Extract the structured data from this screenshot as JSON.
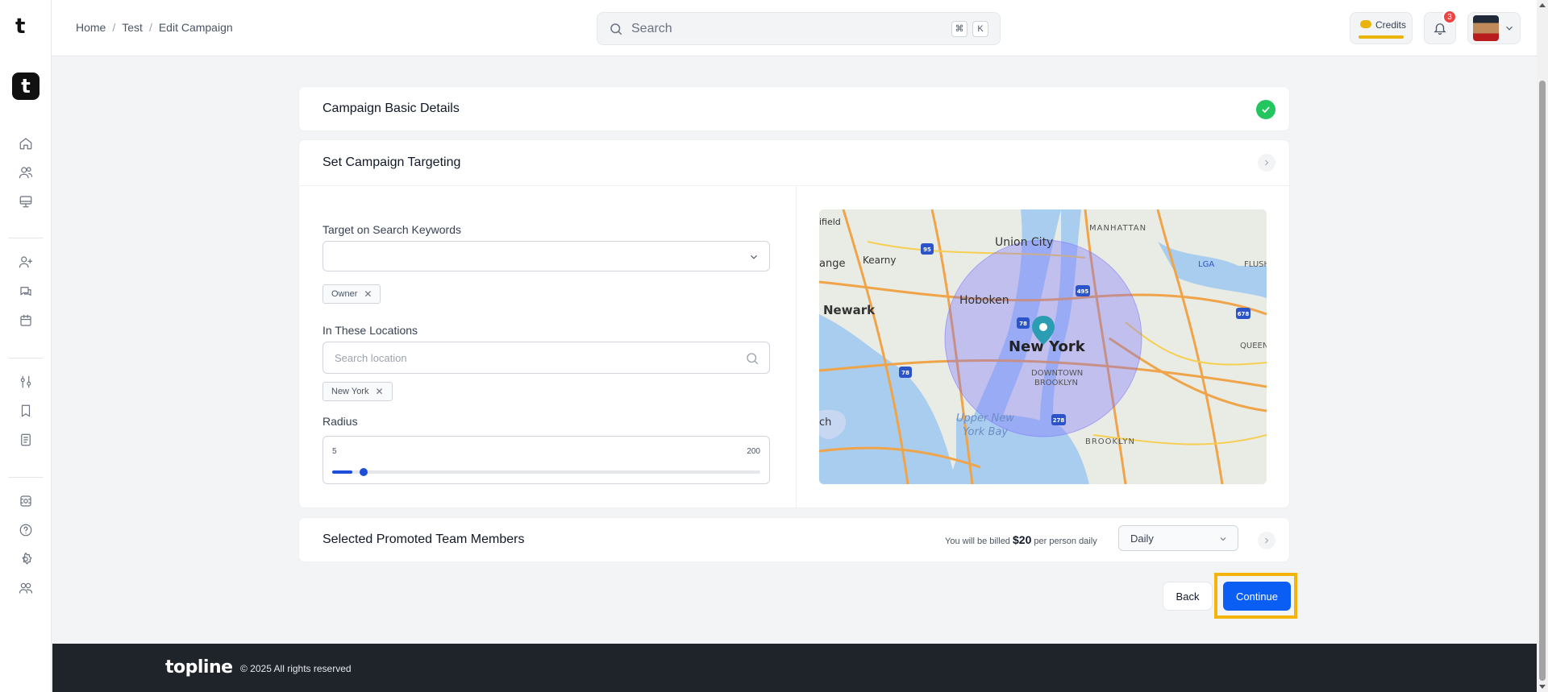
{
  "topbar": {
    "breadcrumb": [
      "Home",
      "Test",
      "Edit Campaign"
    ],
    "search_placeholder": "Search",
    "shortcut_cmd": "⌘",
    "shortcut_key": "K",
    "credits_label": "Credits",
    "notification_count": "3"
  },
  "rail": {
    "logo": "t",
    "app_logo": "t",
    "icons": [
      "home-icon",
      "users-icon",
      "monitor-icon",
      "user-plus-icon",
      "chat-icon",
      "calendar-icon",
      "sliders-icon",
      "bookmark-icon",
      "document-icon",
      "grid-icon",
      "help-icon",
      "settings-icon",
      "team-icon"
    ]
  },
  "sections": {
    "basic_details": "Campaign Basic Details",
    "targeting": "Set Campaign Targeting",
    "team_members": "Selected Promoted Team Members"
  },
  "targeting": {
    "keywords_label": "Target on Search Keywords",
    "keyword_chip": "Owner",
    "locations_label": "In These Locations",
    "location_placeholder": "Search location",
    "location_chip": "New York",
    "radius_label": "Radius",
    "radius_min": "5",
    "radius_max": "200",
    "radius_value_fraction": 0.04
  },
  "map": {
    "labels": [
      "ifield",
      "Union City",
      "MANHATTAN",
      "Kearny",
      "LGA",
      "FLUSH",
      "ange",
      "Hoboken",
      "Newark",
      "New York",
      "QUEEN",
      "DOWNTOWN",
      "BROOKLYN",
      "Upper New",
      "York Bay",
      "BROOKLYN",
      "ch"
    ],
    "shields": [
      "95",
      "495",
      "78",
      "678",
      "78",
      "278"
    ]
  },
  "billing": {
    "prefix": "You will be billed",
    "amount": "$20",
    "suffix": "per person daily",
    "period": "Daily"
  },
  "actions": {
    "back": "Back",
    "continue": "Continue"
  },
  "footer": {
    "brand": "topline",
    "copyright": "© 2025 All rights reserved"
  },
  "colors": {
    "primary": "#0b5ef4",
    "success": "#22c55e",
    "highlight": "#f5b40c",
    "credits": "#eab308",
    "badge": "#ef4444",
    "footer": "#1f242b"
  }
}
